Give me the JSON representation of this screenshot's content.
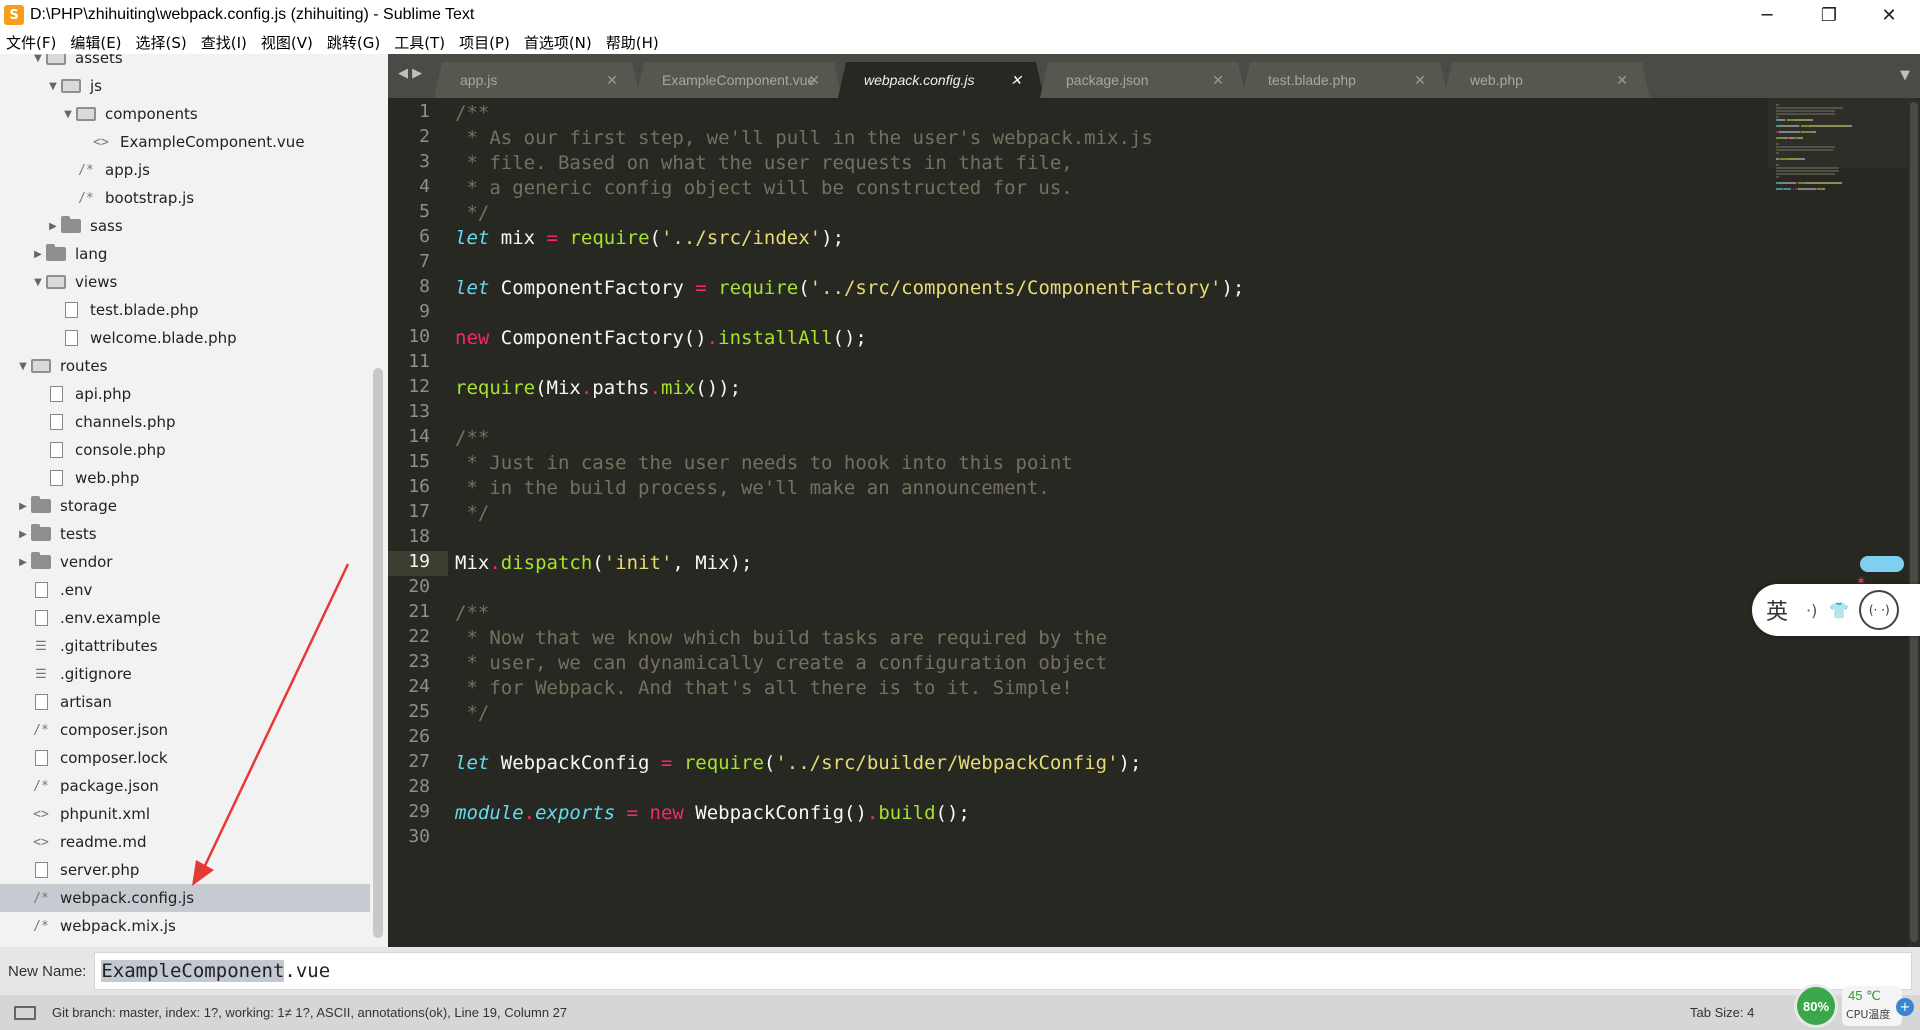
{
  "window": {
    "title": "D:\\PHP\\zhihuiting\\webpack.config.js (zhihuiting) - Sublime Text",
    "minimize": "─",
    "maximize": "❐",
    "close": "✕"
  },
  "menu": [
    "文件(F)",
    "编辑(E)",
    "选择(S)",
    "查找(I)",
    "视图(V)",
    "跳转(G)",
    "工具(T)",
    "项目(P)",
    "首选项(N)",
    "帮助(H)"
  ],
  "sidebar": {
    "items": [
      {
        "label": "assets",
        "icon": "folder-open-icon",
        "arrow": "▼",
        "depth": 2
      },
      {
        "label": "js",
        "icon": "folder-open-icon",
        "arrow": "▼",
        "depth": 3
      },
      {
        "label": "components",
        "icon": "folder-open-icon",
        "arrow": "▼",
        "depth": 4
      },
      {
        "label": "ExampleComponent.vue",
        "icon": "markup-file-icon",
        "glyph": "<>",
        "depth": 5
      },
      {
        "label": "app.js",
        "icon": "script-file-icon",
        "glyph": "/*",
        "depth": 4
      },
      {
        "label": "bootstrap.js",
        "icon": "script-file-icon",
        "glyph": "/*",
        "depth": 4
      },
      {
        "label": "sass",
        "icon": "folder-icon",
        "arrow": "▶",
        "depth": 3
      },
      {
        "label": "lang",
        "icon": "folder-icon",
        "arrow": "▶",
        "depth": 2
      },
      {
        "label": "views",
        "icon": "folder-open-icon",
        "arrow": "▼",
        "depth": 2
      },
      {
        "label": "test.blade.php",
        "icon": "file-icon",
        "depth": 3
      },
      {
        "label": "welcome.blade.php",
        "icon": "file-icon",
        "depth": 3
      },
      {
        "label": "routes",
        "icon": "folder-open-icon",
        "arrow": "▼",
        "depth": 1
      },
      {
        "label": "api.php",
        "icon": "file-icon",
        "depth": 2
      },
      {
        "label": "channels.php",
        "icon": "file-icon",
        "depth": 2
      },
      {
        "label": "console.php",
        "icon": "file-icon",
        "depth": 2
      },
      {
        "label": "web.php",
        "icon": "file-icon",
        "depth": 2
      },
      {
        "label": "storage",
        "icon": "folder-icon",
        "arrow": "▶",
        "depth": 1
      },
      {
        "label": "tests",
        "icon": "folder-icon",
        "arrow": "▶",
        "depth": 1
      },
      {
        "label": "vendor",
        "icon": "folder-icon",
        "arrow": "▶",
        "depth": 1
      },
      {
        "label": ".env",
        "icon": "file-icon",
        "depth": 1
      },
      {
        "label": ".env.example",
        "icon": "file-icon",
        "depth": 1
      },
      {
        "label": ".gitattributes",
        "icon": "lines-file-icon",
        "glyph": "☰",
        "depth": 1
      },
      {
        "label": ".gitignore",
        "icon": "lines-file-icon",
        "glyph": "☰",
        "depth": 1
      },
      {
        "label": "artisan",
        "icon": "file-icon",
        "depth": 1
      },
      {
        "label": "composer.json",
        "icon": "script-file-icon",
        "glyph": "/*",
        "depth": 1
      },
      {
        "label": "composer.lock",
        "icon": "file-icon",
        "depth": 1
      },
      {
        "label": "package.json",
        "icon": "script-file-icon",
        "glyph": "/*",
        "depth": 1
      },
      {
        "label": "phpunit.xml",
        "icon": "markup-file-icon",
        "glyph": "<>",
        "depth": 1
      },
      {
        "label": "readme.md",
        "icon": "markup-file-icon",
        "glyph": "<>",
        "depth": 1
      },
      {
        "label": "server.php",
        "icon": "file-icon",
        "depth": 1
      },
      {
        "label": "webpack.config.js",
        "icon": "script-file-icon",
        "glyph": "/*",
        "depth": 1,
        "selected": true
      },
      {
        "label": "webpack.mix.js",
        "icon": "script-file-icon",
        "glyph": "/*",
        "depth": 1
      }
    ]
  },
  "tabs": [
    {
      "label": "app.js",
      "active": false
    },
    {
      "label": "ExampleComponent.vue",
      "active": false
    },
    {
      "label": "webpack.config.js",
      "active": true
    },
    {
      "label": "package.json",
      "active": false
    },
    {
      "label": "test.blade.php",
      "active": false
    },
    {
      "label": "web.php",
      "active": false
    }
  ],
  "tab_close": "✕",
  "tab_nav": "◀ ▶",
  "tab_dropdown": "▼",
  "editor": {
    "current_line": 19,
    "lines": [
      [
        [
          "c",
          "/**"
        ]
      ],
      [
        [
          "c",
          " * As our first step, we'll pull in the user's webpack.mix.js"
        ]
      ],
      [
        [
          "c",
          " * file. Based on what the user requests in that file,"
        ]
      ],
      [
        [
          "c",
          " * a generic config object will be constructed for us."
        ]
      ],
      [
        [
          "c",
          " */"
        ]
      ],
      [
        [
          "k",
          "let"
        ],
        [
          "pl",
          " mix "
        ],
        [
          "op",
          "="
        ],
        [
          "pl",
          " "
        ],
        [
          "fn",
          "require"
        ],
        [
          "pl",
          "("
        ],
        [
          "s",
          "'../src/index'"
        ],
        [
          "pl",
          ");"
        ]
      ],
      [],
      [
        [
          "k",
          "let"
        ],
        [
          "pl",
          " ComponentFactory "
        ],
        [
          "op",
          "="
        ],
        [
          "pl",
          " "
        ],
        [
          "fn",
          "require"
        ],
        [
          "pl",
          "("
        ],
        [
          "s",
          "'../src/components/ComponentFactory'"
        ],
        [
          "pl",
          ");"
        ]
      ],
      [],
      [
        [
          "kw",
          "new"
        ],
        [
          "pl",
          " ComponentFactory()"
        ],
        [
          "op",
          "."
        ],
        [
          "fn",
          "installAll"
        ],
        [
          "pl",
          "();"
        ]
      ],
      [],
      [
        [
          "fn",
          "require"
        ],
        [
          "pl",
          "(Mix"
        ],
        [
          "op",
          "."
        ],
        [
          "pl",
          "paths"
        ],
        [
          "op",
          "."
        ],
        [
          "fn",
          "mix"
        ],
        [
          "pl",
          "());"
        ]
      ],
      [],
      [
        [
          "c",
          "/**"
        ]
      ],
      [
        [
          "c",
          " * Just in case the user needs to hook into this point"
        ]
      ],
      [
        [
          "c",
          " * in the build process, we'll make an announcement."
        ]
      ],
      [
        [
          "c",
          " */"
        ]
      ],
      [],
      [
        [
          "pl",
          "Mix"
        ],
        [
          "op",
          "."
        ],
        [
          "fn",
          "dispatch"
        ],
        [
          "pl",
          "("
        ],
        [
          "s",
          "'init'"
        ],
        [
          "pl",
          ", Mix);"
        ]
      ],
      [],
      [
        [
          "c",
          "/**"
        ]
      ],
      [
        [
          "c",
          " * Now that we know which build tasks are required by the"
        ]
      ],
      [
        [
          "c",
          " * user, we can dynamically create a configuration object"
        ]
      ],
      [
        [
          "c",
          " * for Webpack. And that's all there is to it. Simple!"
        ]
      ],
      [
        [
          "c",
          " */"
        ]
      ],
      [],
      [
        [
          "k",
          "let"
        ],
        [
          "pl",
          " WebpackConfig "
        ],
        [
          "op",
          "="
        ],
        [
          "pl",
          " "
        ],
        [
          "fn",
          "require"
        ],
        [
          "pl",
          "("
        ],
        [
          "s",
          "'../src/builder/WebpackConfig'"
        ],
        [
          "pl",
          ");"
        ]
      ],
      [],
      [
        [
          "k",
          "module"
        ],
        [
          "op",
          "."
        ],
        [
          "k",
          "exports"
        ],
        [
          "pl",
          " "
        ],
        [
          "op",
          "="
        ],
        [
          "pl",
          " "
        ],
        [
          "kw",
          "new"
        ],
        [
          "pl",
          " WebpackConfig()"
        ],
        [
          "op",
          "."
        ],
        [
          "fn",
          "build"
        ],
        [
          "pl",
          "();"
        ]
      ],
      []
    ]
  },
  "ime": {
    "lang": "英",
    "moon": "·)",
    "shirt": "👕",
    "face": "(· ·)"
  },
  "input_panel": {
    "label": "New Name:",
    "selected": "ExampleComponent",
    "rest": ".vue"
  },
  "status": {
    "text": "Git branch: master, index: 1?, working: 1≠ 1?, ASCII, annotations(ok), Line 19, Column 27",
    "tab_size": "Tab Size: 4"
  },
  "cpu": {
    "percent": "80%",
    "temp": "45 ℃",
    "label": "CPU温度",
    "plus": "+"
  },
  "colors": {
    "comment": "#75715e",
    "keyword": "#66d9ef",
    "storage": "#f92672",
    "function": "#a6e22e",
    "string": "#e6db74",
    "annotation_arrow": "#e53935"
  }
}
